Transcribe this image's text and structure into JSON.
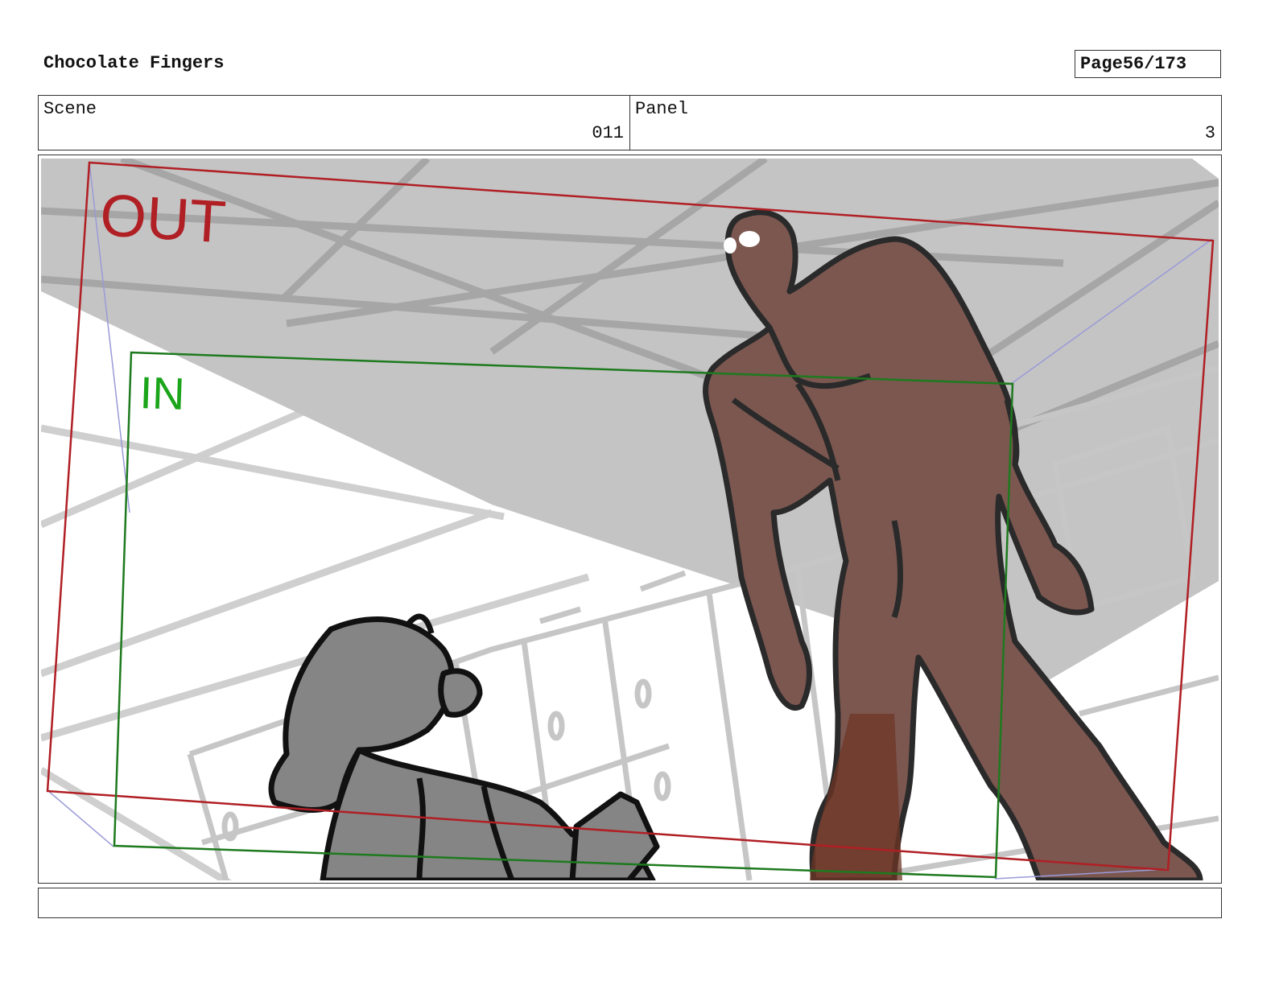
{
  "header": {
    "title": "Chocolate Fingers",
    "page_label": "Page",
    "page_number": "56/173"
  },
  "meta": {
    "scene_label": "Scene",
    "scene_value": "011",
    "panel_label": "Panel",
    "panel_value": "3"
  },
  "frame": {
    "out_label": "OUT",
    "in_label": "IN"
  },
  "colors": {
    "out_frame": "#b01f24",
    "in_frame": "#1e7a1e",
    "in_text": "#1aa51a",
    "creature": "#7b5750",
    "creature_dark": "#6e3626",
    "girl": "#858585",
    "ceiling": "#c4c4c4",
    "guide": "#9a9ad8"
  },
  "notes": {
    "text": ""
  }
}
